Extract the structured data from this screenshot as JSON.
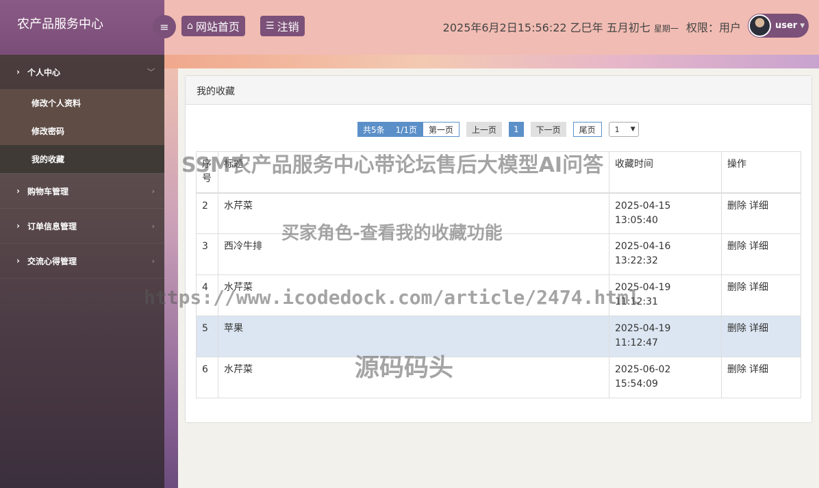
{
  "brand": "农产品服务中心",
  "sidebar": {
    "groups": [
      {
        "label": "个人中心",
        "open": true,
        "items": [
          "修改个人资料",
          "修改密码",
          "我的收藏"
        ]
      },
      {
        "label": "购物车管理"
      },
      {
        "label": "订单信息管理"
      },
      {
        "label": "交流心得管理"
      }
    ]
  },
  "header": {
    "home_label": "网站首页",
    "logout_label": "注销",
    "datetime": "2025年6月2日15:56:22 乙巳年 五月初七",
    "weekday": "星期一",
    "permission": "权限：用户",
    "username": "user"
  },
  "panel": {
    "title": "我的收藏",
    "pager": {
      "total": "共5条",
      "pages": "1/1页",
      "first": "第一页",
      "prev": "上一页",
      "current": "1",
      "next": "下一页",
      "last": "尾页",
      "select_value": "1"
    },
    "table": {
      "headers": [
        "序号",
        "标题",
        "收藏时间",
        "操作"
      ],
      "rows": [
        {
          "no": "2",
          "title": "水芹菜",
          "time": "2025-04-15 13:05:40"
        },
        {
          "no": "3",
          "title": "西冷牛排",
          "time": "2025-04-16 13:22:32"
        },
        {
          "no": "4",
          "title": "水芹菜",
          "time": "2025-04-19 11:12:31"
        },
        {
          "no": "5",
          "title": "苹果",
          "time": "2025-04-19 11:12:47"
        },
        {
          "no": "6",
          "title": "水芹菜",
          "time": "2025-06-02 15:54:09"
        }
      ],
      "delete_label": "删除",
      "detail_label": "详细"
    }
  },
  "watermarks": {
    "line1": "SSM农产品服务中心带论坛售后大模型AI问答",
    "line2": "买家角色-查看我的收藏功能",
    "line3": "https://www.icodedock.com/article/2474.html",
    "line4": "源码码头"
  }
}
